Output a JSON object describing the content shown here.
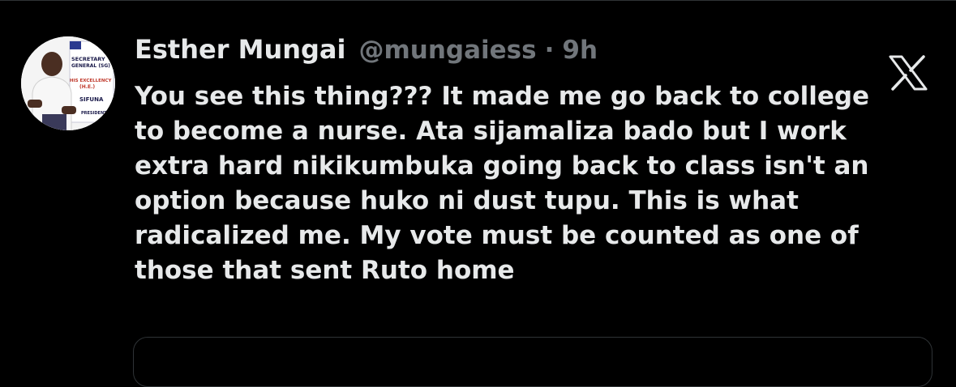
{
  "author": {
    "display_name": "Esther Mungai",
    "handle": "@mungaiess",
    "separator": "·",
    "time": "9h",
    "avatar_icon": "profile-photo-icon",
    "avatar_text": [
      "SECRETARY",
      "GENERAL (SG)",
      "HIS EXCELLENCY",
      "(H.E.)",
      "SIFUNA",
      "PRESIDENT"
    ]
  },
  "brand": {
    "icon": "x-logo-icon",
    "color": "#e7e9ea"
  },
  "tweet": {
    "lines": [
      "You see this thing??? It made me go back to college",
      "to become a nurse. Ata sijamaliza bado but I work",
      "extra hard nikikumbuka going back to class isn't an",
      "option because huko ni dust tupu. This is what",
      "radicalized me. My vote must be counted as one of",
      "those that sent Ruto home"
    ]
  },
  "colors": {
    "background": "#000000",
    "primary_text": "#e7e9ea",
    "secondary_text": "#71767b",
    "border": "#2f3336"
  }
}
